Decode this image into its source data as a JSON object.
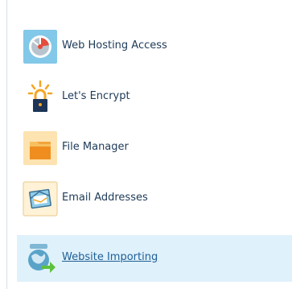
{
  "tools": [
    {
      "label": "Web Hosting Access",
      "icon": "web-hosting-access-icon"
    },
    {
      "label": "Let's Encrypt",
      "icon": "lets-encrypt-lock-icon"
    },
    {
      "label": "File Manager",
      "icon": "folder-icon"
    },
    {
      "label": "Email Addresses",
      "icon": "envelope-icon"
    },
    {
      "label": "Website Importing",
      "icon": "website-importing-icon"
    }
  ],
  "colors": {
    "label_text": "#1d3a57",
    "active_label_text": "#1f5e96",
    "active_row_background": "#dff1fb",
    "left_border": "#d8dde3"
  }
}
